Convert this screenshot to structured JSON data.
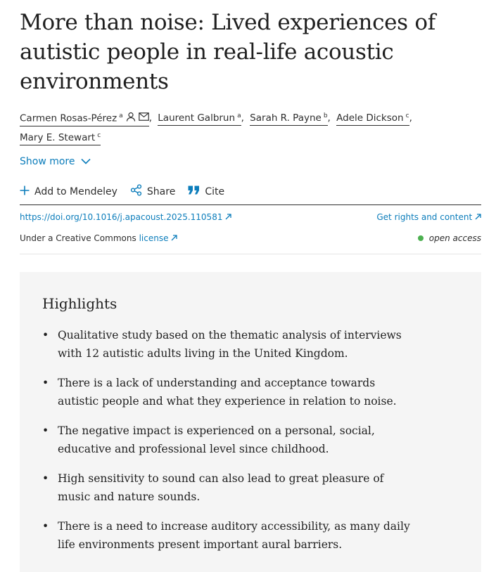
{
  "article": {
    "title": "More than noise: Lived experiences of autistic people in real-life acoustic environments",
    "authors": [
      {
        "name": "Carmen Rosas-Pérez",
        "sup": "a"
      },
      {
        "name": "Laurent Galbrun",
        "sup": "a"
      },
      {
        "name": "Sarah R. Payne",
        "sup": "b"
      },
      {
        "name": "Adele Dickson",
        "sup": "c"
      },
      {
        "name": "Mary E. Stewart",
        "sup": "c"
      }
    ],
    "show_more": "Show more"
  },
  "actions": {
    "mendeley": "Add to Mendeley",
    "share": "Share",
    "cite": "Cite"
  },
  "meta": {
    "doi": "https://doi.org/10.1016/j.apacoust.2025.110581",
    "rights": "Get rights and content",
    "license_prefix": "Under a Creative Commons",
    "license_link": "license",
    "open_access": "open access"
  },
  "highlights": {
    "title": "Highlights",
    "items": [
      "Qualitative study based on the thematic analysis of interviews with 12 autistic adults living in the United Kingdom.",
      "There is a lack of understanding and acceptance towards autistic people and what they experience in relation to noise.",
      "The negative impact is experienced on a personal, social, educative and professional level since childhood.",
      "High sensitivity to sound can also lead to great pleasure of music and nature sounds.",
      "There is a need to increase auditory accessibility, as many daily life environments present important aural barriers."
    ]
  },
  "colors": {
    "link": "#0c7dbb",
    "open_access_dot": "#4cb050",
    "highlights_bg": "#f5f5f5"
  }
}
